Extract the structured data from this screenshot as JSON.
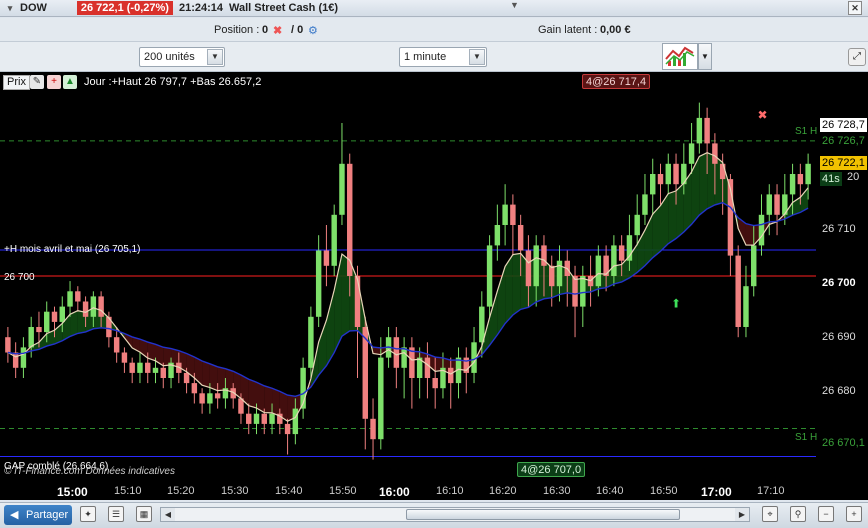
{
  "titlebar": {
    "symbol": "DOW",
    "price": "26 722,1 (-0,27%)",
    "time": "21:24:14",
    "title": "Wall Street Cash (1€)"
  },
  "positionbar": {
    "position_label": "Position :",
    "position_value": "0",
    "slash_value": "/ 0",
    "gain_label": "Gain latent :",
    "gain_value": "0,00 €"
  },
  "toolbar": {
    "units": "200 unités",
    "interval": "1 minute"
  },
  "chart": {
    "prix_label": "Prix",
    "jour_text": "Jour :+Haut 26 797,7 +Bas 26.657,2",
    "red_tag": "4@26 717,4",
    "green_tag": "4@26 707,0",
    "hline_blue_label": "+H mois avril et mai (26 705,1)",
    "hline_red_label": "26 700",
    "gap_label": "GAP comblé (26.664,6)",
    "watermark": "© IT-Finance.com  Données indicatives",
    "s1_top": "S1 H",
    "s1_bottom": "S1 H",
    "countdown": "41s",
    "colors": {
      "background": "#000000",
      "bull": "#7ee06a",
      "bear": "#f08080",
      "ema_fast": "#e8d6b8",
      "ema_slow": "#2233cc",
      "line_red": "#ff2020",
      "line_blue": "#2a2aff",
      "line_green_dash": "#2e8b2e"
    }
  },
  "yaxis": {
    "ticks": [
      "26 728,7",
      "26 726,7",
      "26 722,1",
      "20",
      "26 710",
      "26 700",
      "26 690",
      "26 680",
      "26 670,1"
    ]
  },
  "xaxis": {
    "labels": [
      "15:00",
      "15:10",
      "15:20",
      "15:30",
      "15:40",
      "15:50",
      "16:00",
      "16:10",
      "16:20",
      "16:30",
      "16:40",
      "16:50",
      "17:00",
      "17:10"
    ],
    "bold": [
      true,
      false,
      false,
      false,
      false,
      false,
      true,
      false,
      false,
      false,
      false,
      false,
      true,
      false
    ]
  },
  "bottombar": {
    "share_label": "Partager"
  },
  "candles": [
    [
      26688,
      26685,
      26690,
      26683
    ],
    [
      26685,
      26682,
      26687,
      26680
    ],
    [
      26682,
      26686,
      26688,
      26680
    ],
    [
      26686,
      26690,
      26692,
      26684
    ],
    [
      26690,
      26689,
      26693,
      26686
    ],
    [
      26689,
      26693,
      26695,
      26687
    ],
    [
      26693,
      26691,
      26694,
      26688
    ],
    [
      26691,
      26694,
      26696,
      26689
    ],
    [
      26694,
      26697,
      26699,
      26692
    ],
    [
      26697,
      26695,
      26698,
      26693
    ],
    [
      26695,
      26692,
      26696,
      26690
    ],
    [
      26692,
      26696,
      26697,
      26690
    ],
    [
      26696,
      26692,
      26697,
      26690
    ],
    [
      26692,
      26688,
      26693,
      26686
    ],
    [
      26688,
      26685,
      26690,
      26683
    ],
    [
      26685,
      26683,
      26686,
      26681
    ],
    [
      26683,
      26681,
      26684,
      26679
    ],
    [
      26681,
      26683,
      26685,
      26679
    ],
    [
      26683,
      26681,
      26685,
      26679
    ],
    [
      26681,
      26682,
      26684,
      26679
    ],
    [
      26682,
      26680,
      26683,
      26678
    ],
    [
      26680,
      26683,
      26684,
      26678
    ],
    [
      26683,
      26681,
      26685,
      26679
    ],
    [
      26681,
      26679,
      26682,
      26677
    ],
    [
      26679,
      26677,
      26681,
      26675
    ],
    [
      26677,
      26675,
      26678,
      26673
    ],
    [
      26675,
      26677,
      26679,
      26673
    ],
    [
      26677,
      26676,
      26679,
      26674
    ],
    [
      26676,
      26678,
      26680,
      26674
    ],
    [
      26678,
      26676,
      26679,
      26674
    ],
    [
      26676,
      26673,
      26677,
      26671
    ],
    [
      26673,
      26671,
      26675,
      26669
    ],
    [
      26671,
      26673,
      26675,
      26669
    ],
    [
      26673,
      26671,
      26674,
      26669
    ],
    [
      26671,
      26673,
      26675,
      26669
    ],
    [
      26673,
      26671,
      26674,
      26669
    ],
    [
      26671,
      26669,
      26672,
      26665
    ],
    [
      26669,
      26674,
      26676,
      26667
    ],
    [
      26674,
      26682,
      26684,
      26672
    ],
    [
      26682,
      26692,
      26694,
      26680
    ],
    [
      26692,
      26705,
      26708,
      26690
    ],
    [
      26705,
      26702,
      26710,
      26698
    ],
    [
      26702,
      26712,
      26714,
      26700
    ],
    [
      26712,
      26722,
      26730,
      26710
    ],
    [
      26722,
      26700,
      26724,
      26696
    ],
    [
      26700,
      26690,
      26702,
      26680
    ],
    [
      26690,
      26672,
      26692,
      26666
    ],
    [
      26672,
      26668,
      26676,
      26664
    ],
    [
      26668,
      26684,
      26688,
      26666
    ],
    [
      26684,
      26688,
      26690,
      26682
    ],
    [
      26688,
      26682,
      26690,
      26678
    ],
    [
      26682,
      26686,
      26688,
      26676
    ],
    [
      26686,
      26680,
      26688,
      26674
    ],
    [
      26680,
      26684,
      26686,
      26676
    ],
    [
      26684,
      26680,
      26687,
      26676
    ],
    [
      26680,
      26678,
      26684,
      26674
    ],
    [
      26678,
      26682,
      26685,
      26676
    ],
    [
      26682,
      26679,
      26684,
      26674
    ],
    [
      26679,
      26684,
      26686,
      26676
    ],
    [
      26684,
      26681,
      26686,
      26677
    ],
    [
      26681,
      26687,
      26690,
      26679
    ],
    [
      26687,
      26694,
      26697,
      26684
    ],
    [
      26694,
      26706,
      26708,
      26692
    ],
    [
      26706,
      26710,
      26714,
      26703
    ],
    [
      26710,
      26714,
      26718,
      26706
    ],
    [
      26714,
      26710,
      26716,
      26704
    ],
    [
      26710,
      26705,
      26712,
      26700
    ],
    [
      26705,
      26698,
      26708,
      26694
    ],
    [
      26698,
      26706,
      26708,
      26694
    ],
    [
      26706,
      26702,
      26708,
      26696
    ],
    [
      26702,
      26698,
      26704,
      26694
    ],
    [
      26698,
      26703,
      26706,
      26695
    ],
    [
      26703,
      26700,
      26705,
      26694
    ],
    [
      26700,
      26694,
      26702,
      26688
    ],
    [
      26694,
      26700,
      26702,
      26690
    ],
    [
      26700,
      26698,
      26704,
      26694
    ],
    [
      26698,
      26704,
      26706,
      26696
    ],
    [
      26704,
      26700,
      26706,
      26697
    ],
    [
      26700,
      26706,
      26708,
      26698
    ],
    [
      26706,
      26703,
      26708,
      26700
    ],
    [
      26703,
      26708,
      26712,
      26701
    ],
    [
      26708,
      26712,
      26716,
      26706
    ],
    [
      26712,
      26716,
      26720,
      26710
    ],
    [
      26716,
      26720,
      26723,
      26712
    ],
    [
      26720,
      26718,
      26722,
      26714
    ],
    [
      26718,
      26722,
      26724,
      26716
    ],
    [
      26722,
      26718,
      26724,
      26714
    ],
    [
      26718,
      26722,
      26726,
      26716
    ],
    [
      26722,
      26726,
      26730,
      26720
    ],
    [
      26726,
      26731,
      26734,
      26724
    ],
    [
      26731,
      26726,
      26733,
      26720
    ],
    [
      26726,
      26722,
      26728,
      26716
    ],
    [
      26722,
      26719,
      26724,
      26712
    ],
    [
      26719,
      26704,
      26720,
      26700
    ],
    [
      26704,
      26690,
      26706,
      26688
    ],
    [
      26690,
      26698,
      26702,
      26688
    ],
    [
      26698,
      26706,
      26710,
      26696
    ],
    [
      26706,
      26712,
      26716,
      26704
    ],
    [
      26712,
      26716,
      26718,
      26708
    ],
    [
      26716,
      26712,
      26718,
      26708
    ],
    [
      26712,
      26716,
      26720,
      26710
    ],
    [
      26716,
      26720,
      26722,
      26712
    ],
    [
      26720,
      26718,
      26722,
      26714
    ],
    [
      26718,
      26722,
      26724,
      26715
    ]
  ]
}
